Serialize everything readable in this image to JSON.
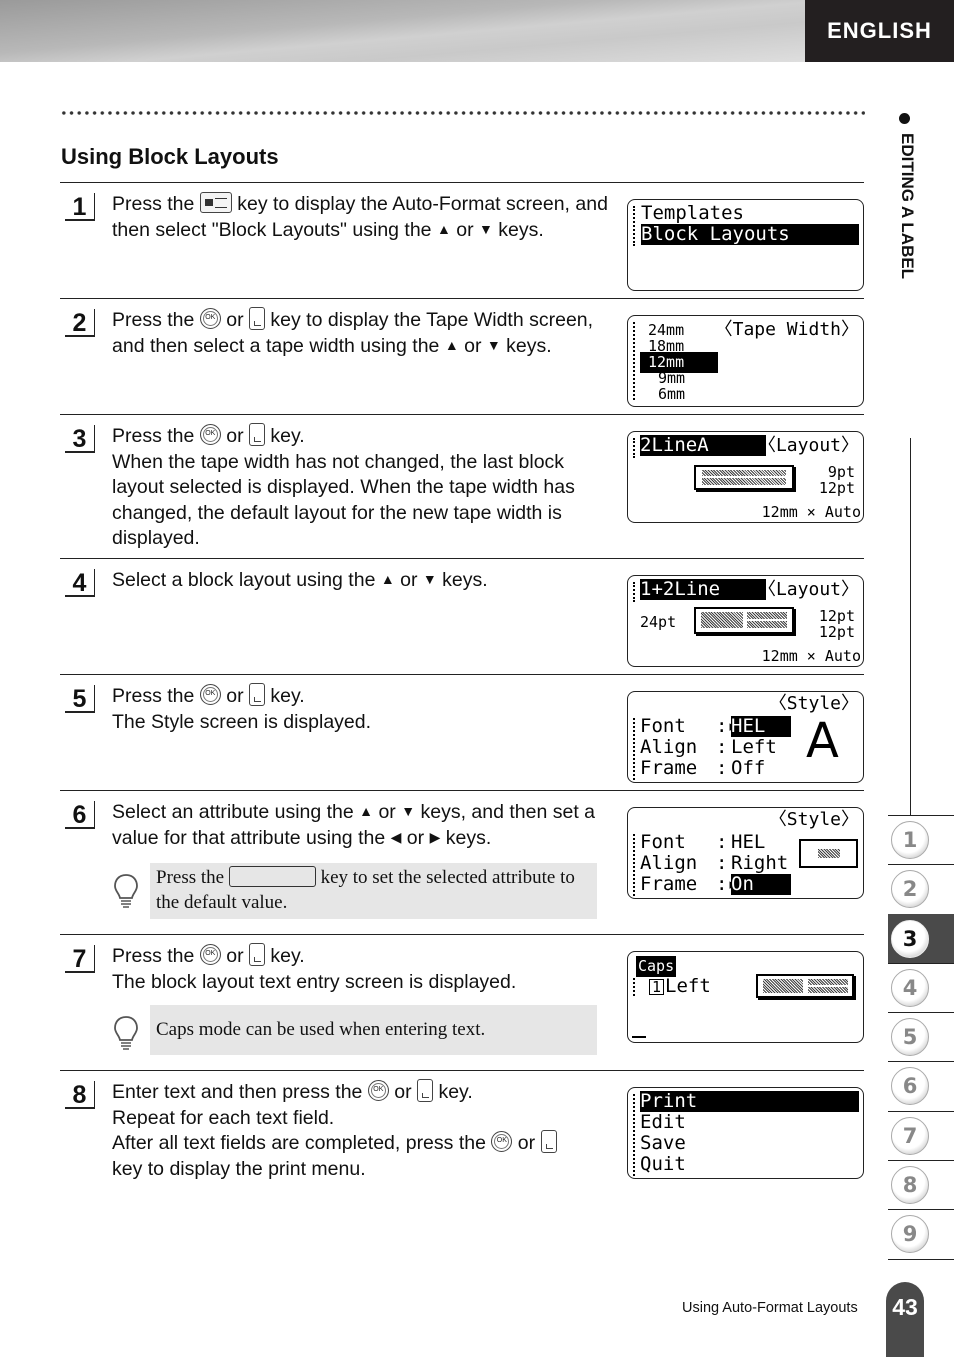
{
  "header": {
    "language": "ENGLISH"
  },
  "section_title": "Using Block Layouts",
  "side_label": "EDITING A LABEL",
  "steps": [
    {
      "number": "1",
      "text_parts": [
        "Press the",
        "key to display the Auto-Format screen, and then select \"Block Layouts\" using the",
        "or",
        "keys."
      ],
      "lcd": {
        "rows": [
          "Templates",
          "Block Layouts"
        ],
        "selected": "Block Layouts"
      }
    },
    {
      "number": "2",
      "text_parts": [
        "Press the",
        "or",
        "key to display the Tape Width screen, and then select a tape width using the",
        "or",
        "keys."
      ],
      "lcd": {
        "title": "〈Tape Width〉",
        "rows": [
          "24mm",
          "18mm",
          "12mm",
          "9mm",
          "6mm"
        ],
        "selected": "12mm"
      }
    },
    {
      "number": "3",
      "text_parts": [
        "Press the",
        "or",
        "key."
      ],
      "text_extra": "When the tape width has not changed, the last block layout selected is displayed. When the tape width has changed, the default layout for the new tape width is displayed.",
      "lcd": {
        "layout_name": "2LineA",
        "title": "〈Layout〉",
        "sizes": [
          "9pt",
          "12pt"
        ],
        "tape": "12mm × Auto"
      }
    },
    {
      "number": "4",
      "text_parts": [
        "Select a block layout using the",
        "or",
        "keys."
      ],
      "lcd": {
        "layout_name": "1+2Line",
        "title": "〈Layout〉",
        "left_size": "24pt",
        "sizes": [
          "12pt",
          "12pt"
        ],
        "tape": "12mm × Auto"
      }
    },
    {
      "number": "5",
      "text_parts": [
        "Press the",
        "or",
        "key."
      ],
      "text_extra": "The Style screen is displayed.",
      "lcd": {
        "title": "〈Style〉",
        "attrs": [
          {
            "name": "Font",
            "value": "HEL",
            "selected": true
          },
          {
            "name": "Align",
            "value": "Left",
            "selected": false
          },
          {
            "name": "Frame",
            "value": "Off",
            "selected": false
          }
        ],
        "preview": "A"
      }
    },
    {
      "number": "6",
      "text_parts": [
        "Select an attribute using the",
        "or",
        "keys, and then set a value for that attribute using the",
        "or",
        "keys."
      ],
      "tip": {
        "parts": [
          "Press the",
          "key to set the selected attribute to the default value."
        ]
      },
      "lcd": {
        "title": "〈Style〉",
        "attrs": [
          {
            "name": "Font",
            "value": "HEL",
            "selected": false
          },
          {
            "name": "Align",
            "value": "Right",
            "selected": false
          },
          {
            "name": "Frame",
            "value": "On",
            "selected": true
          }
        ]
      }
    },
    {
      "number": "7",
      "text_parts": [
        "Press the",
        "or",
        "key."
      ],
      "text_extra": "The block layout text entry screen is displayed.",
      "tip": {
        "text": "Caps mode can be used when entering text."
      },
      "lcd": {
        "caps": "Caps",
        "field_no": "1",
        "field_label": "Left"
      }
    },
    {
      "number": "8",
      "text_parts": [
        "Enter text and then press the",
        "or",
        "key.",
        "Repeat for each text field.",
        "After all text fields are completed, press the",
        "or",
        "key to display the print menu."
      ],
      "lcd": {
        "rows": [
          "Print",
          "Edit",
          "Save",
          "Quit"
        ],
        "selected": "Print"
      }
    }
  ],
  "key_labels": {
    "ok": "OK"
  },
  "chapter_tabs": [
    "1",
    "2",
    "3",
    "4",
    "5",
    "6",
    "7",
    "8",
    "9"
  ],
  "active_chapter": "3",
  "footer": {
    "text": "Using Auto-Format Layouts",
    "page_number": "43"
  }
}
